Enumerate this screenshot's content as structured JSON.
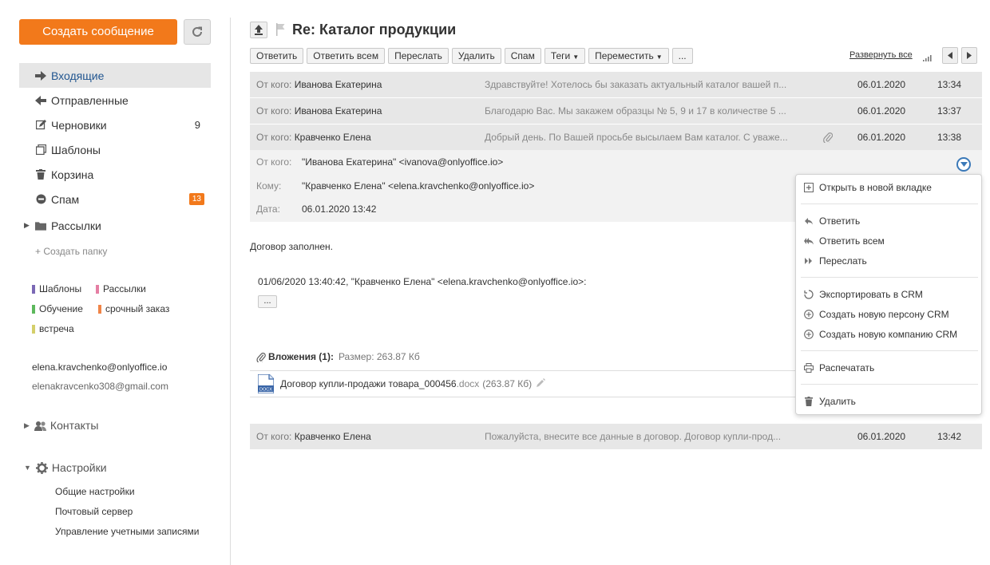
{
  "sidebar": {
    "compose_label": "Создать сообщение",
    "folders": [
      {
        "label": "Входящие",
        "icon": "arrow-right-icon",
        "active": true
      },
      {
        "label": "Отправленные",
        "icon": "reply-arrow-icon"
      },
      {
        "label": "Черновики",
        "icon": "edit-icon",
        "count": "9"
      },
      {
        "label": "Шаблоны",
        "icon": "template-icon"
      },
      {
        "label": "Корзина",
        "icon": "trash-icon"
      },
      {
        "label": "Спам",
        "icon": "spam-icon",
        "badge": "13"
      },
      {
        "label": "Рассылки",
        "icon": "folder-icon"
      }
    ],
    "create_folder": "+ Создать папку",
    "tags": [
      {
        "label": "Шаблоны",
        "color": "#7b68b5"
      },
      {
        "label": "Рассылки",
        "color": "#e57ea3"
      },
      {
        "label": "Обучение",
        "color": "#5cb85c"
      },
      {
        "label": "срочный заказ",
        "color": "#f08447"
      },
      {
        "label": "встреча",
        "color": "#d4cf6a"
      }
    ],
    "accounts": [
      "elena.kravchenko@onlyoffice.io",
      "elenakravcenko308@gmail.com"
    ],
    "contacts_label": "Контакты",
    "settings_label": "Настройки",
    "settings_links": [
      "Общие настройки",
      "Почтовый сервер",
      "Управление учетными записями"
    ]
  },
  "main": {
    "subject": "Re: Каталог продукции",
    "toolbar": [
      "Ответить",
      "Ответить всем",
      "Переслать",
      "Удалить",
      "Спам",
      "Теги",
      "Переместить",
      "..."
    ],
    "expand_all": "Развернуть все",
    "from_prefix": "От кого:",
    "messages": [
      {
        "from": "Иванова Екатерина",
        "snippet": "Здравствуйте! Хотелось бы заказать актуальный каталог вашей п...",
        "date": "06.01.2020",
        "time": "13:34"
      },
      {
        "from": "Иванова Екатерина",
        "snippet": "Благодарю Вас. Мы закажем образцы № 5, 9 и 17 в количестве 5 ...",
        "date": "06.01.2020",
        "time": "13:37"
      },
      {
        "from": "Кравченко Елена",
        "snippet": "Добрый день. По Вашей просьбе высылаем Вам каталог. С уваже...",
        "date": "06.01.2020",
        "time": "13:38"
      }
    ],
    "last_message": {
      "from": "Кравченко Елена",
      "snippet": "Пожалуйста, внесите все данные в договор. Договор купли-прод...",
      "date": "06.01.2020",
      "time": "13:42"
    },
    "open_header": {
      "from_label": "От кого:",
      "from_value": "\"Иванова Екатерина\" <ivanova@onlyoffice.io>",
      "to_label": "Кому:",
      "to_value": "\"Кравченко Елена\" <elena.kravchenko@onlyoffice.io>",
      "date_label": "Дата:",
      "date_value": "06.01.2020 13:42"
    },
    "body": "Договор заполнен.",
    "quote_line": "01/06/2020 13:40:42, \"Кравченко Елена\" <elena.kravchenko@onlyoffice.io>:",
    "quote_ellipsis": "...",
    "attachments": {
      "title": "Вложения (1):",
      "size_label": "Размер: 263.87 Кб",
      "file_name": "Договор купли-продажи товара_000456",
      "file_ext": ".docx",
      "file_size": "(263.87 Кб)",
      "file_icon_label": "DOCX"
    }
  },
  "context_menu": {
    "items": [
      {
        "label": "Открыть в новой вкладке",
        "icon": "new-tab-icon"
      },
      {
        "label": "Ответить",
        "icon": "reply-icon"
      },
      {
        "label": "Ответить всем",
        "icon": "reply-all-icon"
      },
      {
        "label": "Переслать",
        "icon": "forward-icon"
      },
      {
        "label": "Экспортировать в CRM",
        "icon": "export-crm-icon"
      },
      {
        "label": "Создать новую персону CRM",
        "icon": "add-person-icon"
      },
      {
        "label": "Создать новую компанию CRM",
        "icon": "add-company-icon"
      },
      {
        "label": "Распечатать",
        "icon": "print-icon"
      },
      {
        "label": "Удалить",
        "icon": "trash-icon"
      }
    ]
  },
  "colors": {
    "accent": "#f2791b",
    "active_link": "#225690",
    "row_bg": "#e7e7e7"
  }
}
